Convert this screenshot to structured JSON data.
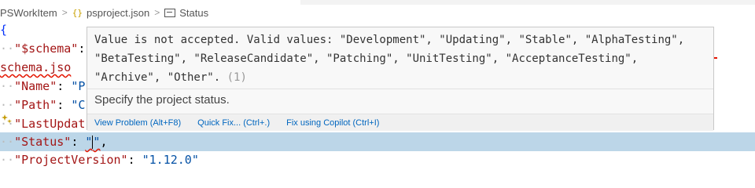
{
  "breadcrumb": {
    "items": [
      "PSWorkItem",
      "psproject.json",
      "Status"
    ],
    "separator": ">",
    "json_icon": "{}"
  },
  "editor": {
    "open_brace": "{",
    "lines": [
      {
        "key": "\"$schema\"",
        "colon": ":"
      },
      {
        "text": "schema.jso"
      },
      {
        "key": "\"Name\"",
        "colon": ":",
        "value": "\"P"
      },
      {
        "key": "\"Path\"",
        "colon": ":",
        "value": "\"C"
      },
      {
        "key": "\"LastUpdat"
      },
      {
        "key": "\"Status\"",
        "colon": ":",
        "value_open": "\"",
        "value_close": "\"",
        "comma": ","
      },
      {
        "key": "\"ProjectVersion\"",
        "colon": ":",
        "value": "\"1.12.0\""
      }
    ],
    "whitespace_dot": "··"
  },
  "hover": {
    "message": "Value is not accepted. Valid values: \"Development\", \"Updating\", \"Stable\", \"AlphaTesting\", \"BetaTesting\", \"ReleaseCandidate\", \"Patching\", \"UnitTesting\", \"AcceptanceTesting\", \"Archive\", \"Other\".",
    "code": "(1)",
    "description": "Specify the project status.",
    "actions": [
      "View Problem (Alt+F8)",
      "Quick Fix... (Ctrl+.)",
      "Fix using Copilot (Ctrl+I)"
    ]
  },
  "icons": {
    "lightbulb": "lightbulb-sparkle-icon",
    "status": "symbol-string-icon",
    "json": "json-braces-icon"
  },
  "colors": {
    "current_line": "#bcd6e8",
    "error": "#e51400",
    "link": "#0066bf",
    "key": "#a31515"
  }
}
